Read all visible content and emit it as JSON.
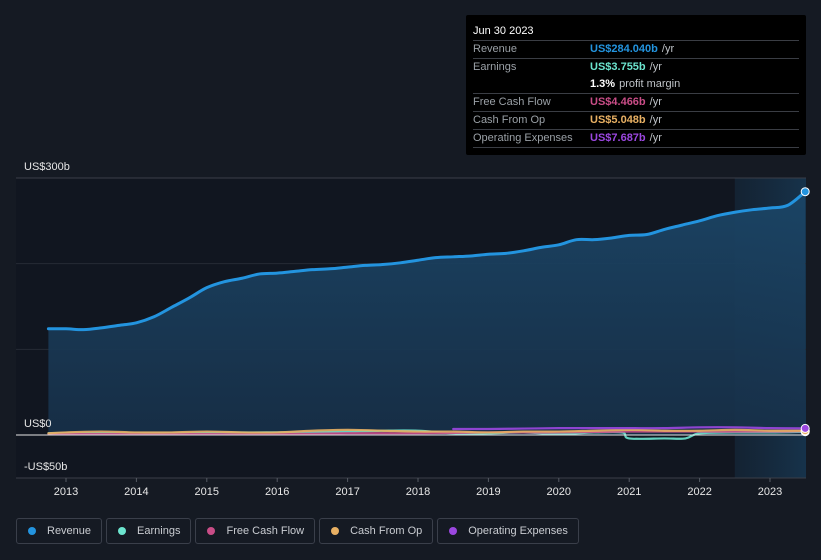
{
  "tooltip": {
    "date": "Jun 30 2023",
    "rows": [
      {
        "label": "Revenue",
        "value": "US$284.040b",
        "unit": "/yr",
        "color": "#2394df"
      },
      {
        "label": "Earnings",
        "value": "US$3.755b",
        "unit": "/yr",
        "color": "#6ce5cf"
      },
      {
        "label": "",
        "value": "1.3%",
        "unit": "profit margin",
        "color": "#ffffff"
      },
      {
        "label": "Free Cash Flow",
        "value": "US$4.466b",
        "unit": "/yr",
        "color": "#c94d87"
      },
      {
        "label": "Cash From Op",
        "value": "US$5.048b",
        "unit": "/yr",
        "color": "#e8b063"
      },
      {
        "label": "Operating Expenses",
        "value": "US$7.687b",
        "unit": "/yr",
        "color": "#9b47e0"
      }
    ]
  },
  "legend": [
    {
      "label": "Revenue",
      "color": "#2394df"
    },
    {
      "label": "Earnings",
      "color": "#6ce5cf"
    },
    {
      "label": "Free Cash Flow",
      "color": "#c94d87"
    },
    {
      "label": "Cash From Op",
      "color": "#e8b063"
    },
    {
      "label": "Operating Expenses",
      "color": "#9b47e0"
    }
  ],
  "chart_data": {
    "type": "area",
    "title": "",
    "xlabel": "",
    "ylabel": "",
    "y_tick_labels": [
      {
        "value": 300,
        "label": "US$300b"
      },
      {
        "value": 0,
        "label": "US$0"
      },
      {
        "value": -50,
        "label": "-US$50b"
      }
    ],
    "ylim": [
      -55,
      300
    ],
    "xlim": [
      2012.25,
      2023.55
    ],
    "x_tick_labels": [
      "2013",
      "2014",
      "2015",
      "2016",
      "2017",
      "2018",
      "2019",
      "2020",
      "2021",
      "2022",
      "2023"
    ],
    "grid": true,
    "forecast_shade_from": 2022.5,
    "series": [
      {
        "name": "Revenue",
        "color": "#2394df",
        "fill": true,
        "x": [
          2012.75,
          2013.0,
          2013.25,
          2013.5,
          2013.75,
          2014.0,
          2014.25,
          2014.5,
          2014.75,
          2015.0,
          2015.25,
          2015.5,
          2015.75,
          2016.0,
          2016.25,
          2016.5,
          2016.75,
          2017.0,
          2017.25,
          2017.5,
          2017.75,
          2018.0,
          2018.25,
          2018.5,
          2018.75,
          2019.0,
          2019.25,
          2019.5,
          2019.75,
          2020.0,
          2020.25,
          2020.5,
          2020.75,
          2021.0,
          2021.25,
          2021.5,
          2021.75,
          2022.0,
          2022.25,
          2022.5,
          2022.75,
          2023.0,
          2023.25,
          2023.5
        ],
        "y": [
          124,
          124,
          123,
          125,
          128,
          131,
          138,
          149,
          160,
          172,
          179,
          183,
          188,
          189,
          191,
          193,
          194,
          196,
          198,
          199,
          201,
          204,
          207,
          208,
          209,
          211,
          212,
          215,
          219,
          222,
          228,
          228,
          230,
          233,
          234,
          240,
          245,
          250,
          256,
          260,
          263,
          265,
          268,
          284
        ]
      },
      {
        "name": "Earnings",
        "color": "#6ce5cf",
        "fill": false,
        "x": [
          2012.75,
          2013.5,
          2014.5,
          2015.5,
          2016.5,
          2017.0,
          2017.5,
          2018.0,
          2018.5,
          2019.0,
          2019.5,
          2020.0,
          2020.5,
          2020.9,
          2021.0,
          2021.5,
          2021.8,
          2022.0,
          2022.5,
          2023.0,
          2023.5
        ],
        "y": [
          2,
          2,
          2,
          3,
          3,
          4,
          5,
          5,
          2,
          2,
          3,
          1,
          3,
          3,
          -4,
          -4,
          -4,
          2,
          3,
          3,
          3.8
        ]
      },
      {
        "name": "Free Cash Flow",
        "color": "#c94d87",
        "fill": false,
        "x": [
          2012.75,
          2014,
          2015,
          2016,
          2017,
          2018,
          2019,
          2020,
          2021,
          2022,
          2023,
          2023.5
        ],
        "y": [
          1,
          1,
          1,
          1,
          2,
          2,
          3,
          3,
          4,
          4,
          4,
          4.5
        ]
      },
      {
        "name": "Cash From Op",
        "color": "#e8b063",
        "fill": false,
        "x": [
          2012.75,
          2013.0,
          2013.5,
          2014.0,
          2014.5,
          2015.0,
          2015.5,
          2016.0,
          2016.5,
          2017.0,
          2017.5,
          2018.0,
          2018.5,
          2019.0,
          2019.5,
          2020.0,
          2020.5,
          2021.0,
          2021.5,
          2022.0,
          2022.5,
          2023.0,
          2023.5
        ],
        "y": [
          2,
          3,
          4,
          3,
          3,
          4,
          3,
          3,
          5,
          6,
          5,
          4,
          4,
          3,
          4,
          4,
          5,
          6,
          5,
          5,
          6,
          5,
          5
        ]
      },
      {
        "name": "Operating Expenses",
        "color": "#9b47e0",
        "fill": false,
        "x": [
          2018.5,
          2019.0,
          2019.5,
          2020.0,
          2020.5,
          2021.0,
          2021.5,
          2022.0,
          2022.5,
          2023.0,
          2023.5
        ],
        "y": [
          7,
          7,
          7.5,
          8,
          8,
          8,
          8,
          9,
          9,
          8,
          7.7
        ]
      }
    ]
  }
}
